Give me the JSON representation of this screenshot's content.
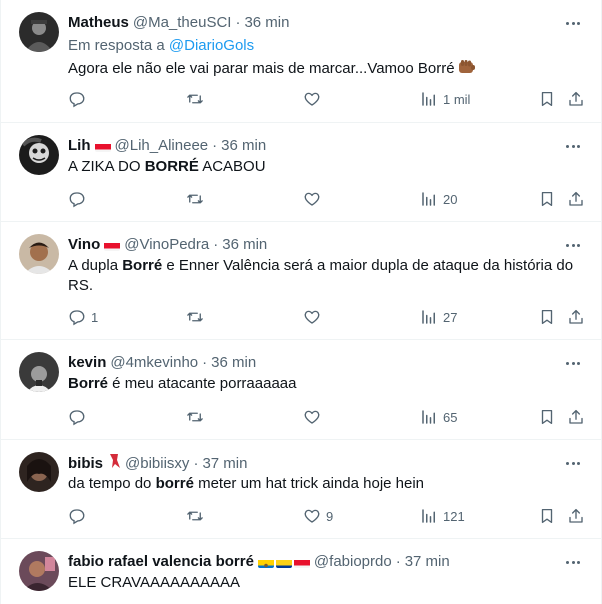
{
  "replies": [
    {
      "name": "Matheus",
      "handle": "@Ma_theuSCI",
      "time": "36 min",
      "reply_to_prefix": "Em resposta a",
      "reply_to_link": "@DiarioGols",
      "text_before": "Agora ele não ele vai parar mais de marcar...Vamoo Borré",
      "emoji": "fist-emoji",
      "replies": "",
      "retweets": "",
      "likes": "",
      "views": "1 mil"
    },
    {
      "name": "Lih",
      "handle": "@Lih_Alineee",
      "time": "36 min",
      "text_before": "A ZIKA DO ",
      "text_bold": "BORRÉ",
      "text_after": " ACABOU",
      "views": "20"
    },
    {
      "name": "Vino",
      "handle": "@VinoPedra",
      "time": "36 min",
      "text_before": "A dupla ",
      "text_bold": "Borré",
      "text_after": " e Enner Valência será a maior dupla de ataque da história do RS.",
      "replies": "1",
      "views": "27"
    },
    {
      "name": "kevin",
      "handle": "@4mkevinho",
      "time": "36 min",
      "text_before": "",
      "text_bold": "Borré",
      "text_after": " é meu atacante porraaaaaa",
      "views": "65"
    },
    {
      "name": "bibis",
      "handle": "@bibiisxy",
      "time": "37 min",
      "text_before": "da tempo do ",
      "text_bold": "borré",
      "text_after": " meter um hat trick ainda hoje hein",
      "likes": "9",
      "views": "121"
    },
    {
      "name": "fabio rafael valencia borré",
      "handle": "@fabioprdo",
      "time": "37 min",
      "text_before": "ELE CRAVAAAAAAAAAA"
    }
  ],
  "dot_separator": "·",
  "colors": {
    "text": "#0f1419",
    "secondary": "#536471",
    "link": "#1d9bf0",
    "divider": "#eff3f4"
  },
  "icons": [
    "reply-icon",
    "retweet-icon",
    "like-icon",
    "views-icon",
    "bookmark-icon",
    "share-icon",
    "more-icon"
  ]
}
